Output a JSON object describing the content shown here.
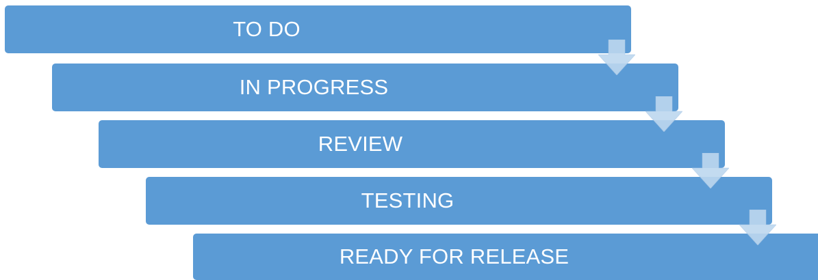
{
  "diagram": {
    "type": "staggered-process",
    "colors": {
      "step_fill": "#5b9bd5",
      "step_text": "#ffffff",
      "arrow_fill": "#bdd7ee",
      "arrow_edge": "#a9c8e6"
    },
    "steps": [
      {
        "label": "TO DO"
      },
      {
        "label": "IN PROGRESS"
      },
      {
        "label": "REVIEW"
      },
      {
        "label": "TESTING"
      },
      {
        "label": "READY FOR RELEASE"
      }
    ],
    "connector_icon": "arrow-down-icon"
  }
}
